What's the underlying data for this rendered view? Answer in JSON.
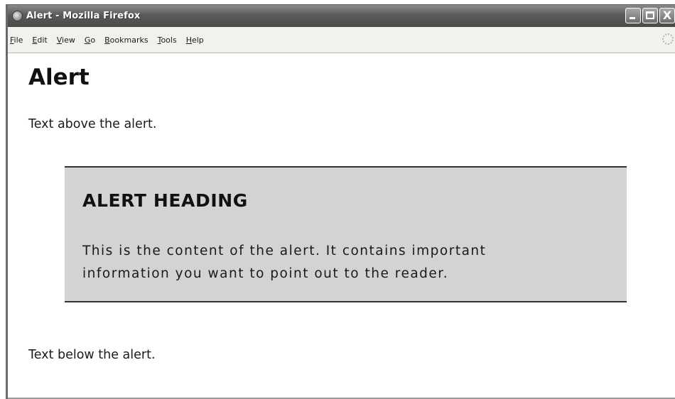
{
  "window": {
    "title": "Alert - Mozilla Firefox",
    "controls": {
      "minimize": "_",
      "maximize": "□",
      "close": "X"
    }
  },
  "menubar": {
    "items": [
      {
        "accel": "F",
        "rest": "ile"
      },
      {
        "accel": "E",
        "rest": "dit"
      },
      {
        "accel": "V",
        "rest": "iew"
      },
      {
        "accel": "G",
        "rest": "o"
      },
      {
        "accel": "B",
        "rest": "ookmarks"
      },
      {
        "accel": "T",
        "rest": "ools"
      },
      {
        "accel": "H",
        "rest": "elp"
      }
    ]
  },
  "page": {
    "title": "Alert",
    "text_above": "Text above the alert.",
    "alert": {
      "heading": "ALERT HEADING",
      "body_line1": "This is the content of the alert. It contains important",
      "body_line2": "information you want to point out to the reader."
    },
    "text_below": "Text below the alert."
  },
  "colors": {
    "alert_background": "#d3d3d3",
    "alert_border": "#333333",
    "titlebar": "#5b5b5b"
  }
}
